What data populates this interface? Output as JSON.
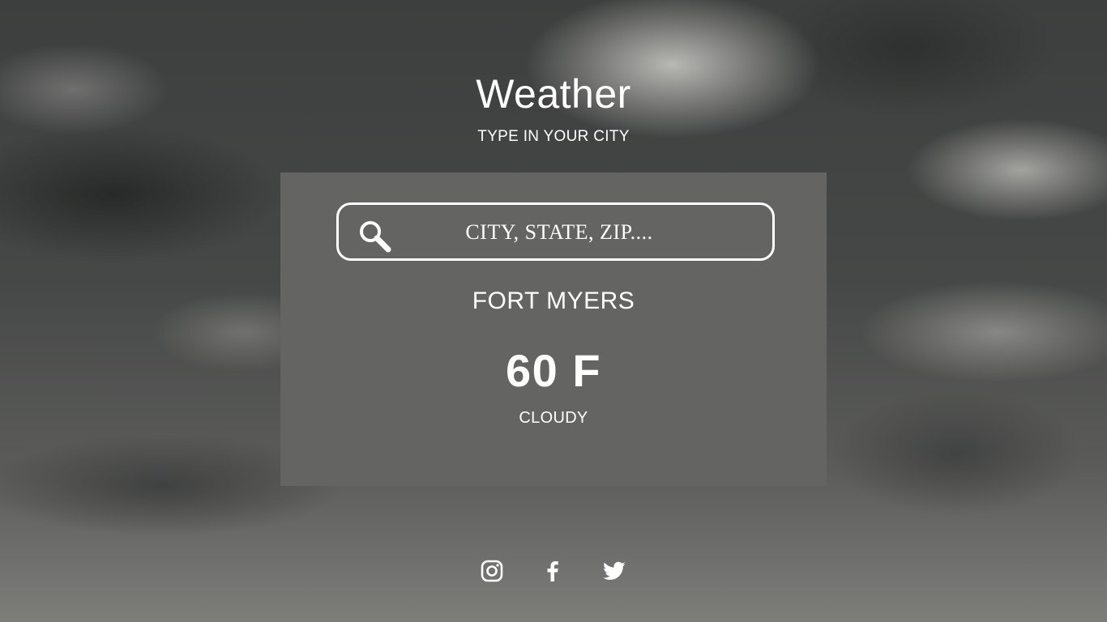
{
  "header": {
    "title": "Weather",
    "subtitle": "TYPE IN YOUR CITY"
  },
  "search": {
    "placeholder": "CITY, STATE, ZIP....",
    "value": "",
    "icon": "search-icon"
  },
  "weather": {
    "city": "FORT MYERS",
    "temperature": "60 F",
    "condition": "CLOUDY"
  },
  "social": [
    {
      "name": "instagram",
      "icon": "instagram-icon"
    },
    {
      "name": "facebook",
      "icon": "facebook-icon"
    },
    {
      "name": "twitter",
      "icon": "twitter-icon"
    }
  ],
  "colors": {
    "card_background": "#646462",
    "text": "#ffffff"
  }
}
